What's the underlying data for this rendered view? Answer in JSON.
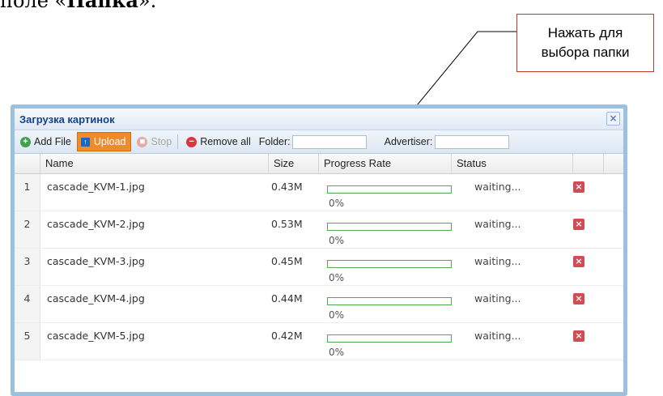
{
  "heading": {
    "prefix": "поле «",
    "bold": "Папка",
    "suffix": "»."
  },
  "callout": {
    "line1": "Нажать для",
    "line2": "выбора папки"
  },
  "window": {
    "title": "Загрузка картинок",
    "close_glyph": "×"
  },
  "toolbar": {
    "add_file": "Add File",
    "upload": "Upload",
    "stop": "Stop",
    "remove_all": "Remove all",
    "folder_label": "Folder:",
    "folder_value": "",
    "advertiser_label": "Advertiser:",
    "advertiser_value": ""
  },
  "columns": {
    "name": "Name",
    "size": "Size",
    "progress": "Progress Rate",
    "status": "Status"
  },
  "files": [
    {
      "num": "1",
      "name": "cascade_KVM-1.jpg",
      "size": "0.43M",
      "progress": 0,
      "progress_label": "0%",
      "status": "waiting..."
    },
    {
      "num": "2",
      "name": "cascade_KVM-2.jpg",
      "size": "0.53M",
      "progress": 0,
      "progress_label": "0%",
      "status": "waiting..."
    },
    {
      "num": "3",
      "name": "cascade_KVM-3.jpg",
      "size": "0.45M",
      "progress": 0,
      "progress_label": "0%",
      "status": "waiting..."
    },
    {
      "num": "4",
      "name": "cascade_KVM-4.jpg",
      "size": "0.44M",
      "progress": 0,
      "progress_label": "0%",
      "status": "waiting..."
    },
    {
      "num": "5",
      "name": "cascade_KVM-5.jpg",
      "size": "0.42M",
      "progress": 0,
      "progress_label": "0%",
      "status": "waiting..."
    }
  ],
  "icons": {
    "add": "plus-circle-icon",
    "upload": "upload-icon",
    "stop": "stop-icon",
    "remove": "remove-icon",
    "delete": "delete-icon"
  },
  "colors": {
    "accent": "#f08b2a",
    "progress": "#53a853",
    "delete": "#d24b55",
    "callout_border": "#c0392b"
  }
}
